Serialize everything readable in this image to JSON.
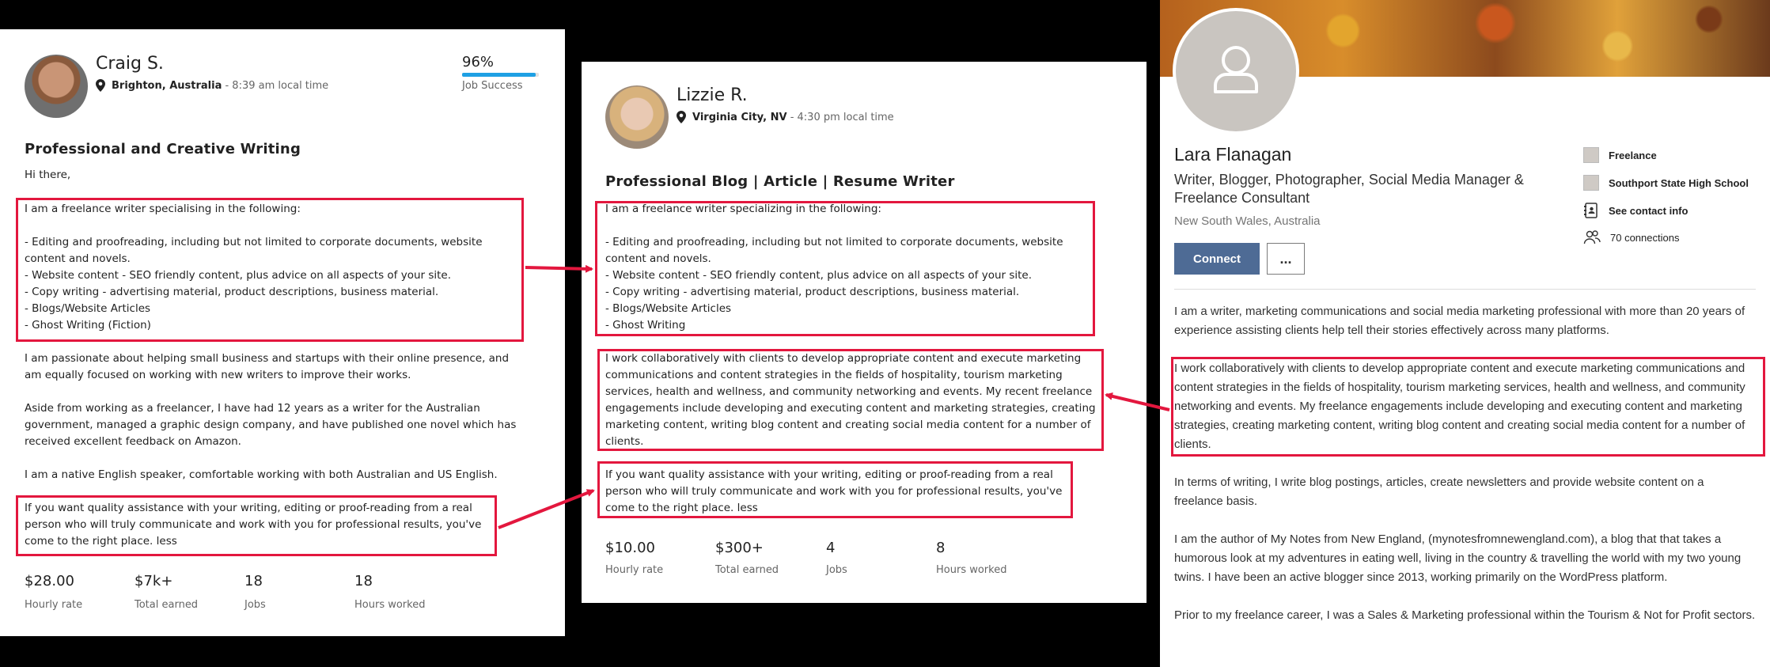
{
  "colors": {
    "highlight": "#e3173e",
    "job_success_bar": "#1ea0e4",
    "connect_button": "#4e6b95"
  },
  "profile1": {
    "name": "Craig S.",
    "location": "Brighton, Australia",
    "local_time": " - 8:39 am local time",
    "job_success_pct": "96%",
    "job_success_value": 0.96,
    "job_success_label": "Job Success",
    "title": "Professional and Creative Writing",
    "greeting": "Hi there,",
    "intro": "I am a freelance writer specialising in the following:\n\n- Editing and proofreading, including but not limited to corporate documents, website\ncontent and novels.\n- Website content - SEO friendly content, plus advice on all aspects of your site.\n- Copy writing - advertising material, product descriptions, business material.\n- Blogs/Website Articles\n- Ghost Writing (Fiction)",
    "passion": "I am passionate about helping small business and startups with their online presence, and\nam equally focused on working with new writers to improve their works.",
    "experience": "Aside from working as a freelancer, I have had 12 years as a writer for the Australian\ngovernment, managed a graphic design company, and have published one novel which has\nreceived excellent feedback on Amazon.",
    "language": "I am a native English speaker, comfortable working with both Australian and US English.",
    "closing": "If you want quality assistance with your writing, editing or proof-reading from a real\nperson who will truly communicate and work with you for professional results, you've\ncome to the right place. less",
    "stats": [
      {
        "value": "$28.00",
        "label": "Hourly rate"
      },
      {
        "value": "$7k+",
        "label": "Total earned"
      },
      {
        "value": "18",
        "label": "Jobs"
      },
      {
        "value": "18",
        "label": "Hours worked"
      }
    ]
  },
  "profile2": {
    "name": "Lizzie R.",
    "location": "Virginia City, NV",
    "local_time": " - 4:30 pm local time",
    "title": "Professional Blog | Article | Resume Writer",
    "intro": "I am a freelance writer specializing in the following:\n\n- Editing and proofreading, including but not limited to corporate documents, website\ncontent and novels.\n- Website content - SEO friendly content, plus advice on all aspects of your site.\n- Copy writing - advertising material, product descriptions, business material.\n- Blogs/Website Articles\n- Ghost Writing",
    "collab": "I work collaboratively with clients to develop appropriate content and execute marketing\ncommunications and content strategies in the fields of hospitality, tourism marketing\nservices, health and wellness, and community networking and events. My recent freelance\nengagements include developing and executing content and marketing strategies, creating\nmarketing content, writing blog content and creating social media content for a number of\nclients.",
    "closing": "If you want quality assistance with your writing, editing or proof-reading from a real\nperson who will truly communicate and work with you for professional results, you've\ncome to the right place. less",
    "stats": [
      {
        "value": "$10.00",
        "label": "Hourly rate"
      },
      {
        "value": "$300+",
        "label": "Total earned"
      },
      {
        "value": "4",
        "label": "Jobs"
      },
      {
        "value": "8",
        "label": "Hours worked"
      }
    ]
  },
  "profile3": {
    "name": "Lara Flanagan",
    "headline": "Writer, Blogger, Photographer, Social Media Manager & Freelance Consultant",
    "location": "New South Wales, Australia",
    "connect_label": "Connect",
    "more_label": "...",
    "side": {
      "company": "Freelance",
      "school": "Southport State High School",
      "contact": "See contact info",
      "connections": "70 connections"
    },
    "about1": "I am a writer, marketing communications and social media marketing professional with more than 20 years of experience assisting clients help tell their stories effectively across many platforms.",
    "about2": "I work collaboratively with clients to develop appropriate content and execute marketing communications and content strategies in the fields of hospitality, tourism marketing services, health and wellness, and community networking and events. My freelance engagements include developing and executing content and marketing strategies, creating marketing content, writing blog content and creating social media content for a number of clients.",
    "about3": "In terms of writing, I write blog postings, articles, create newsletters and provide website content on a freelance basis.",
    "about4": "I am the author of My Notes from New England, (mynotesfromnewengland.com), a blog that that takes a humorous look at my adventures in eating well, living in the country & travelling the world with my two young twins. I have been an active blogger since 2013, working primarily on the WordPress platform.",
    "about5": "Prior to my freelance career, I was a Sales & Marketing professional within the Tourism & Not for Profit sectors."
  }
}
